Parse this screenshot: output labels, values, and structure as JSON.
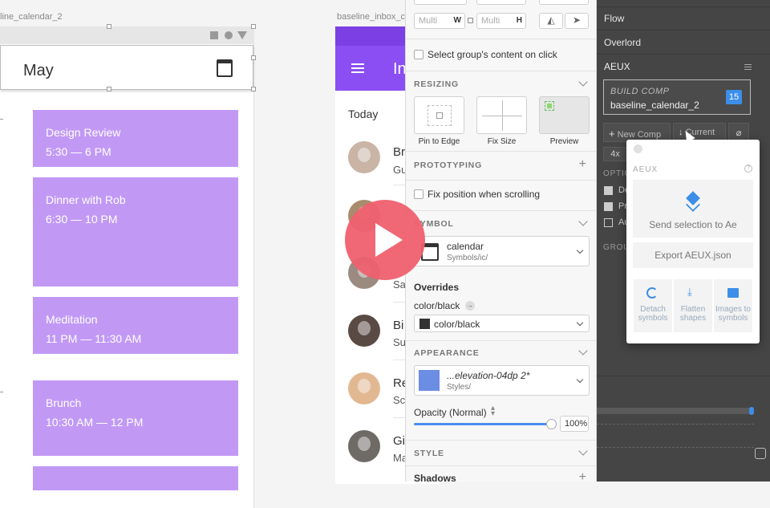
{
  "calendar": {
    "artboard_label": "line_calendar_2",
    "month_title": "May",
    "events": [
      {
        "title": "Design Review",
        "time": "5:30 — 6 PM"
      },
      {
        "title": "Dinner with Rob",
        "time": "6:30 — 10 PM"
      },
      {
        "title": "Meditation",
        "time": "11 PM — 11:30 AM"
      },
      {
        "title": "Brunch",
        "time": "10:30 AM — 12 PM"
      }
    ],
    "event_color": "#c199f5"
  },
  "inbox": {
    "artboard_label": "baseline_inbox_c",
    "title": "In",
    "section": "Today",
    "rows": [
      {
        "sender": "Br",
        "subject": "Gu"
      },
      {
        "sender": "",
        "subject": ""
      },
      {
        "sender": "",
        "subject": "Sa"
      },
      {
        "sender": "Bi",
        "subject": "Su"
      },
      {
        "sender": "Re",
        "subject": "Sc"
      },
      {
        "sender": "Gi",
        "subject": "Ma"
      }
    ],
    "accent": "#8a4ef2"
  },
  "inspector": {
    "multi_w": "Multi",
    "w_label": "W",
    "multi_h": "Multi",
    "h_label": "H",
    "select_group_label": "Select group's content on click",
    "resizing": {
      "title": "RESIZING",
      "options": [
        "Pin to Edge",
        "Fix Size",
        "Preview"
      ]
    },
    "prototyping": {
      "title": "PROTOTYPING",
      "fix_position_label": "Fix position when scrolling"
    },
    "symbol": {
      "title": "SYMBOL",
      "name": "calendar",
      "path": "Symbols/ic/",
      "overrides_title": "Overrides",
      "override_label": "color/black",
      "override_value": "color/black"
    },
    "appearance": {
      "title": "APPEARANCE",
      "style_name": "...elevation-04dp 2*",
      "style_path": "Styles/",
      "opacity_label": "Opacity (Normal)",
      "opacity_value": "100%",
      "opacity_fraction": 1.0,
      "swatch_color": "#6b8de3"
    },
    "style_title": "STYLE",
    "shadows_title": "Shadows"
  },
  "plugin_panel": {
    "rows": [
      "Flow",
      "Overlord"
    ],
    "aeux_title": "AEUX",
    "build_comp_label": "BUILD COMP",
    "build_comp_name": "baseline_calendar_2",
    "badge_count": "15",
    "new_comp_label": "New Comp",
    "current_label": "Current",
    "scale_label": "4x",
    "options_label": "OPTIO",
    "group_label": "GROU",
    "option_items": [
      "De",
      "Pr",
      "Au"
    ]
  },
  "aeux_popover": {
    "title": "AEUX",
    "send_label": "Send selection to Ae",
    "export_label": "Export AEUX.json",
    "actions": [
      {
        "label": "Detach symbols"
      },
      {
        "label": "Flatten shapes"
      },
      {
        "label": "Images to symbols"
      }
    ],
    "accent": "#3c8ee8"
  },
  "video": {
    "play_icon": "play-icon",
    "color": "#ef606e"
  }
}
